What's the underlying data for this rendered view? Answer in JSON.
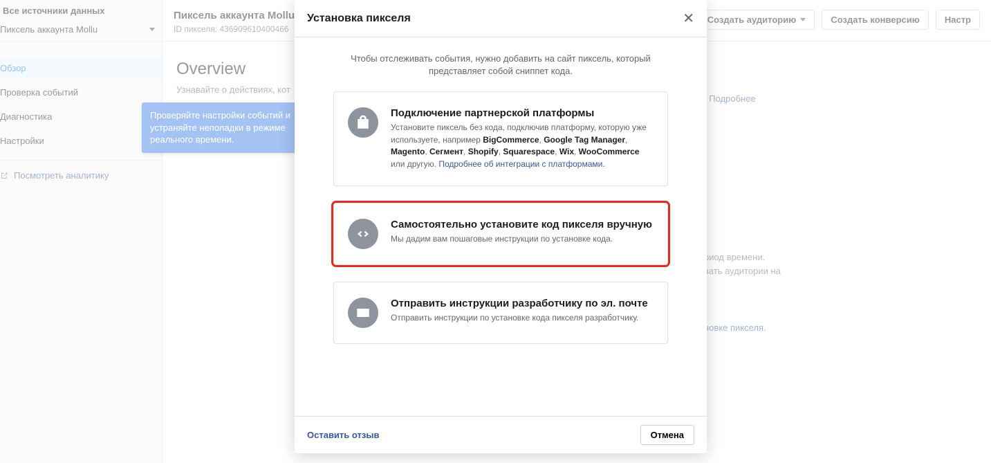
{
  "sidebar": {
    "title": "Все источники данных",
    "selector_label": "Пиксель аккаунта Mollu",
    "nav": [
      {
        "label": "Обзор",
        "active": true
      },
      {
        "label": "Проверка событий",
        "active": false
      },
      {
        "label": "Диагностика",
        "active": false
      },
      {
        "label": "Настройки",
        "active": false
      }
    ],
    "analytics_label": "Посмотреть аналитику"
  },
  "tooltip": "Проверяйте настройки событий и устраняйте неполадки в режиме реального времени.",
  "page": {
    "title": "Пиксель аккаунта Mollu",
    "id_label": "ID пикселя: 436909610400466",
    "buttons": {
      "create_audience": "Создать аудиторию",
      "create_conversion": "Создать конверсию",
      "setup": "Настр"
    },
    "overview_heading": "Overview",
    "desc_prefix": "Узнавайте о действиях, кот",
    "desc_more": "Подробнее",
    "hint1_a": "риод времени.",
    "hint1_b": "вать аудитории на",
    "hint2_suffix": "новке пикселя."
  },
  "modal": {
    "title": "Установка пикселя",
    "intro": "Чтобы отслеживать события, нужно добавить на сайт пиксель, который представляет собой сниппет кода.",
    "options": {
      "partner": {
        "title": "Подключение партнерской платформы",
        "desc_prefix": "Установите пиксель без кода, подключив платформу, которую уже используете, например ",
        "platforms": [
          "BigCommerce",
          "Google Tag Manager",
          "Magento",
          "Сегмент",
          "Shopify",
          "Squarespace",
          "Wix",
          "WooCommerce"
        ],
        "desc_suffix_1": " или другую. ",
        "link": "Подробнее об интеграции с платформами."
      },
      "manual": {
        "title": "Самостоятельно установите код пикселя вручную",
        "desc": "Мы дадим вам пошаговые инструкции по установке кода."
      },
      "email": {
        "title": "Отправить инструкции разработчику по эл. почте",
        "desc": "Отправить инструкции по установке кода пикселя разработчику."
      }
    },
    "footer": {
      "feedback": "Оставить отзыв",
      "cancel": "Отмена"
    }
  }
}
